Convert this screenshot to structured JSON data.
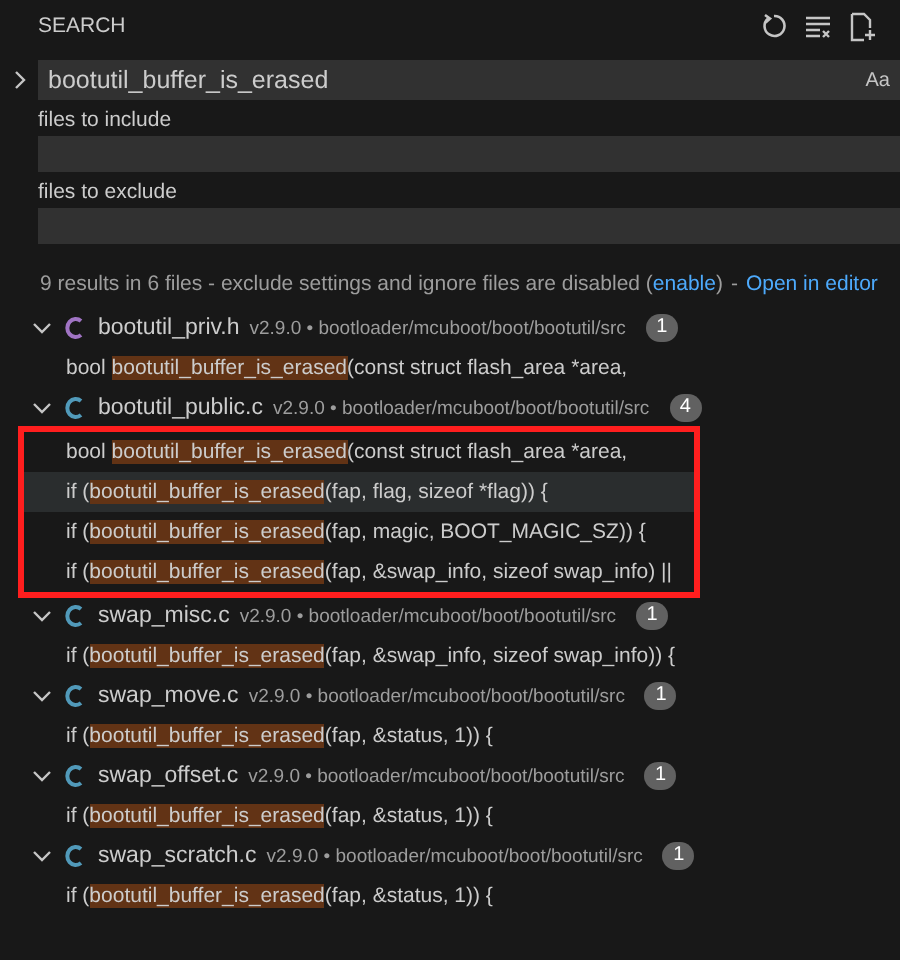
{
  "panel": {
    "title": "SEARCH"
  },
  "search": {
    "value": "bootutil_buffer_is_erased",
    "toggle": "Aa"
  },
  "include": {
    "label": "files to include"
  },
  "exclude": {
    "label": "files to exclude"
  },
  "summary": {
    "text": "9 results in 6 files - exclude settings and ignore files are disabled (",
    "link": "enable",
    "close": ")",
    "separator": "-",
    "open_link": "Open in editor"
  },
  "files": [
    {
      "name": "bootutil_priv.h",
      "path": "v2.9.0 • bootloader/mcuboot/boot/bootutil/src",
      "count": "1",
      "color": "#a074c4",
      "expanded": true,
      "framed": false,
      "matches": [
        {
          "before": "bool ",
          "match": "bootutil_buffer_is_erased",
          "after": "(const struct flash_area *area,",
          "selected": false
        }
      ]
    },
    {
      "name": "bootutil_public.c",
      "path": "v2.9.0 • bootloader/mcuboot/boot/bootutil/src",
      "count": "4",
      "color": "#519aba",
      "expanded": true,
      "framed": true,
      "matches": [
        {
          "before": "bool ",
          "match": "bootutil_buffer_is_erased",
          "after": "(const struct flash_area *area,",
          "selected": false
        },
        {
          "before": "if (",
          "match": "bootutil_buffer_is_erased",
          "after": "(fap, flag, sizeof *flag)) {",
          "selected": true
        },
        {
          "before": "if (",
          "match": "bootutil_buffer_is_erased",
          "after": "(fap, magic, BOOT_MAGIC_SZ)) {",
          "selected": false
        },
        {
          "before": "if (",
          "match": "bootutil_buffer_is_erased",
          "after": "(fap, &swap_info, sizeof swap_info) ||",
          "selected": false
        }
      ]
    },
    {
      "name": "swap_misc.c",
      "path": "v2.9.0 • bootloader/mcuboot/boot/bootutil/src",
      "count": "1",
      "color": "#519aba",
      "expanded": true,
      "framed": false,
      "matches": [
        {
          "before": "if (",
          "match": "bootutil_buffer_is_erased",
          "after": "(fap, &swap_info, sizeof swap_info)) {",
          "selected": false
        }
      ]
    },
    {
      "name": "swap_move.c",
      "path": "v2.9.0 • bootloader/mcuboot/boot/bootutil/src",
      "count": "1",
      "color": "#519aba",
      "expanded": true,
      "framed": false,
      "matches": [
        {
          "before": "if (",
          "match": "bootutil_buffer_is_erased",
          "after": "(fap, &status, 1)) {",
          "selected": false
        }
      ]
    },
    {
      "name": "swap_offset.c",
      "path": "v2.9.0 • bootloader/mcuboot/boot/bootutil/src",
      "count": "1",
      "color": "#519aba",
      "expanded": true,
      "framed": false,
      "matches": [
        {
          "before": "if (",
          "match": "bootutil_buffer_is_erased",
          "after": "(fap, &status, 1)) {",
          "selected": false
        }
      ]
    },
    {
      "name": "swap_scratch.c",
      "path": "v2.9.0 • bootloader/mcuboot/boot/bootutil/src",
      "count": "1",
      "color": "#519aba",
      "expanded": true,
      "framed": false,
      "matches": [
        {
          "before": "if (",
          "match": "bootutil_buffer_is_erased",
          "after": "(fap, &status, 1)) {",
          "selected": false
        }
      ]
    }
  ]
}
